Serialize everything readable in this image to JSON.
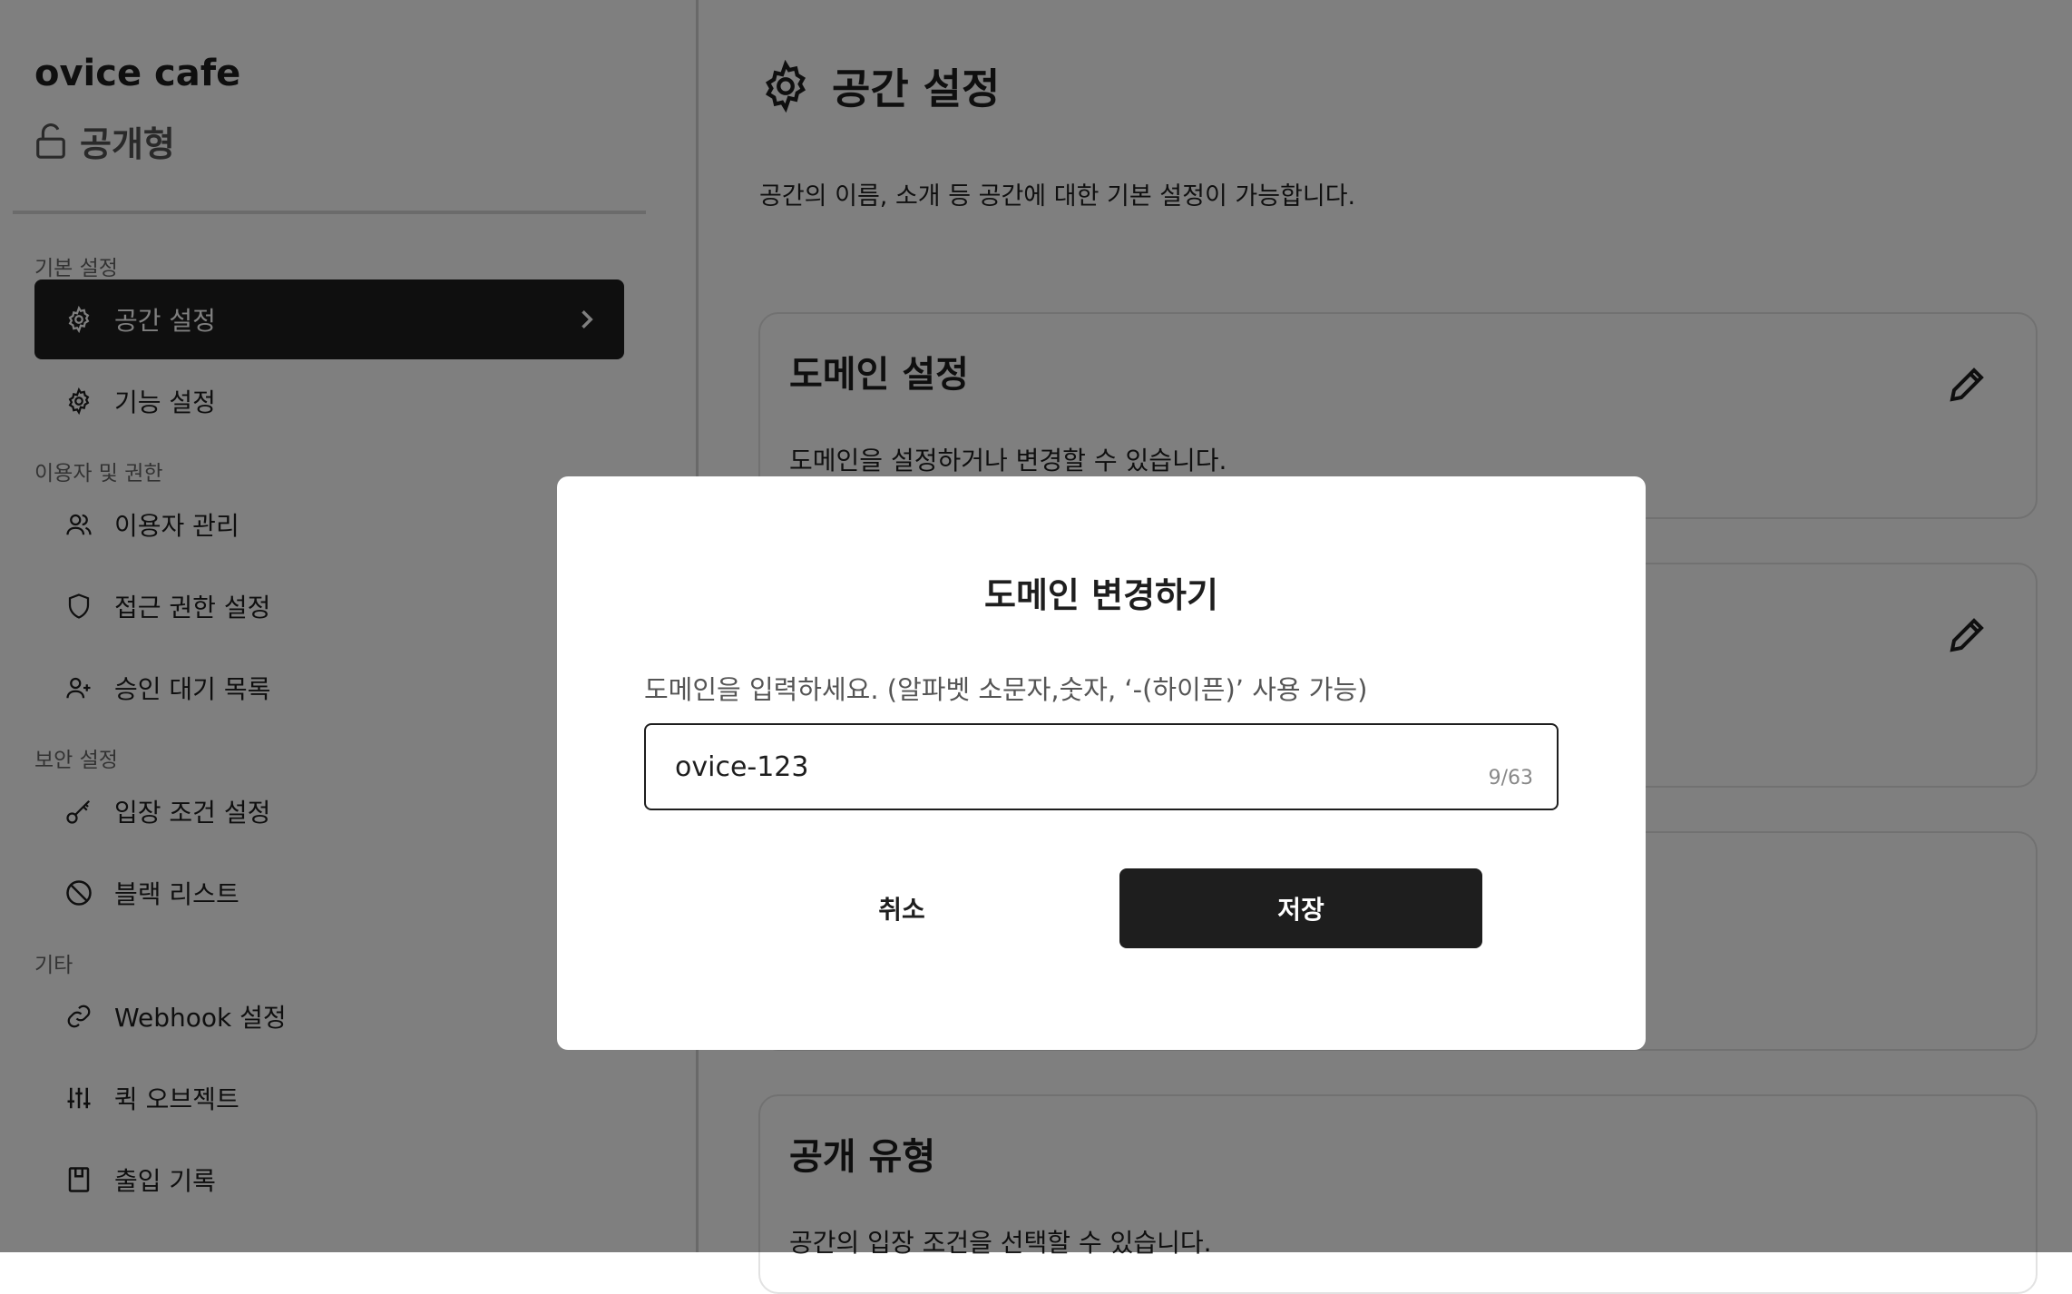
{
  "sidebar": {
    "space_name": "ovice cafe",
    "space_type": "공개형",
    "sections": {
      "basic": "기본 설정",
      "users": "이용자 및 권한",
      "security": "보안 설정",
      "other": "기타"
    },
    "items": [
      {
        "label": "공간 설정",
        "icon": "gear-icon",
        "active": true
      },
      {
        "label": "기능 설정",
        "icon": "gear-icon"
      },
      {
        "label": "이용자 관리",
        "icon": "users-icon"
      },
      {
        "label": "접근 권한 설정",
        "icon": "shield-icon"
      },
      {
        "label": "승인 대기 목록",
        "icon": "user-plus-icon"
      },
      {
        "label": "입장 조건 설정",
        "icon": "key-icon"
      },
      {
        "label": "블랙 리스트",
        "icon": "ban-icon"
      },
      {
        "label": "Webhook 설정",
        "icon": "link-icon"
      },
      {
        "label": "퀵 오브젝트",
        "icon": "sliders-icon"
      },
      {
        "label": "출입 기록",
        "icon": "book-icon"
      }
    ]
  },
  "main": {
    "title": "공간 설정",
    "description": "공간의 이름, 소개 등 공간에 대한 기본 설정이 가능합니다.",
    "cards": [
      {
        "title": "도메인 설정",
        "description": "도메인을 설정하거나 변경할 수 있습니다."
      },
      {
        "title": "",
        "description": ""
      },
      {
        "title": "",
        "description": ""
      },
      {
        "title": "공개 유형",
        "description": "공간의 입장 조건을 선택할 수 있습니다."
      }
    ]
  },
  "modal": {
    "title": "도메인 변경하기",
    "help": "도메인을 입력하세요. (알파벳 소문자,숫자, ‘-(하이픈)’ 사용 가능)",
    "input_value": "ovice-123",
    "char_count": "9/63",
    "cancel_label": "취소",
    "save_label": "저장"
  },
  "colors": {
    "primary": "#1e1e1e",
    "overlay": "rgba(0,0,0,0.5)",
    "border": "#e2e2e2"
  }
}
